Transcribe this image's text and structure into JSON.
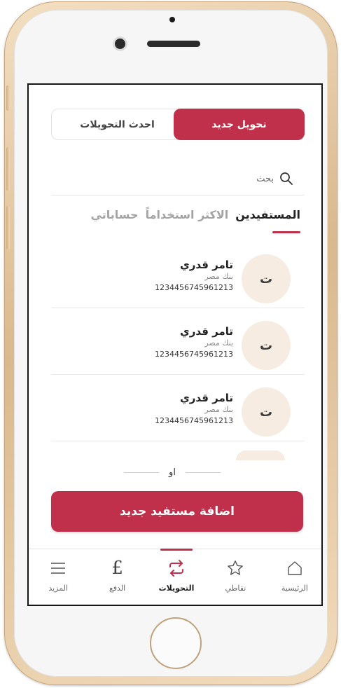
{
  "colors": {
    "accent": "#c0304a",
    "avatar_bg": "#f6ece1"
  },
  "segmented": {
    "new_transfer": "تحويل جديد",
    "recent_transfers": "احدث التحويلات"
  },
  "search": {
    "placeholder": "بحث",
    "icon": "search-icon"
  },
  "tabs": [
    {
      "label": "المستفيدين",
      "active": true
    },
    {
      "label": "الاكثر استخداماً",
      "active": false
    },
    {
      "label": "حساباتي",
      "active": false
    }
  ],
  "beneficiaries": [
    {
      "initial": "ت",
      "name": "تامر قدري",
      "bank": "بنك مصر",
      "account": "1234456745961213"
    },
    {
      "initial": "ت",
      "name": "تامر قدري",
      "bank": "بنك مصر",
      "account": "1234456745961213"
    },
    {
      "initial": "ت",
      "name": "تامر قدري",
      "bank": "بنك مصر",
      "account": "1234456745961213"
    }
  ],
  "divider": {
    "or": "او"
  },
  "add_button": "اضافة مستفيد جديد",
  "bottom_nav": [
    {
      "label": "الرئيسية",
      "icon": "home-icon",
      "active": false
    },
    {
      "label": "نقاطي",
      "icon": "star-icon",
      "active": false
    },
    {
      "label": "التحويلات",
      "icon": "transfer-arrows-icon",
      "active": true
    },
    {
      "label": "الدفع",
      "icon": "pound-icon",
      "active": false
    },
    {
      "label": "المزيد",
      "icon": "menu-icon",
      "active": false
    }
  ]
}
